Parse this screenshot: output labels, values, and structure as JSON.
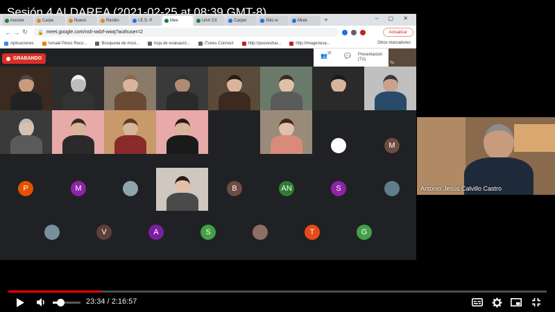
{
  "video": {
    "title": "Sesión 4 ALDAREA (2021-02-25 at 08:39 GMT-8)",
    "current_time": "23:34",
    "separator": " / ",
    "duration": "2:16:57",
    "progress_fraction": 0.172,
    "volume_fraction": 0.28
  },
  "browser": {
    "tabs": [
      {
        "label": "mooser",
        "color": "#188038"
      },
      {
        "label": "Carpe",
        "color": "#ea8600"
      },
      {
        "label": "Nuevo",
        "color": "#ea8600"
      },
      {
        "label": "Resttin",
        "color": "#ea8600"
      },
      {
        "label": "I.E.S. P",
        "color": "#1a73e8"
      },
      {
        "label": "Mee",
        "color": "#188038"
      },
      {
        "label": "UAX Cit",
        "color": "#188038"
      },
      {
        "label": "Carpet",
        "color": "#1a73e8"
      },
      {
        "label": "Sitio w",
        "color": "#1a73e8"
      },
      {
        "label": "Misle",
        "color": "#1a73e8"
      }
    ],
    "url": "meet.google.com/nsh-wdzf-wwq?authuser=2",
    "update_label": "Actualizar",
    "bookmarks": [
      {
        "label": "Aplicaciones",
        "color": "#4285f4"
      },
      {
        "label": "Ismael Perez Reco...",
        "color": "#ea8600"
      },
      {
        "label": "Búsqueda de músi...",
        "color": "#5f6368"
      },
      {
        "label": "hoja de evaluació...",
        "color": "#5f6368"
      },
      {
        "label": "iTunes Connect",
        "color": "#5f6368"
      },
      {
        "label": "http://pooveshar...",
        "color": "#c5221f"
      },
      {
        "label": "http://imagenesa...",
        "color": "#c5221f"
      }
    ],
    "bookmarks_other": "Otros marcadores"
  },
  "meet": {
    "recording_label": "GRABANDO",
    "participant_count": "32",
    "presentation_label": "Presentación (Tú)",
    "self_label": "Tú",
    "speaker_name": "Antonio Jesús Calvillo Castro",
    "avatars": [
      {
        "letter": "",
        "color": "#ffffff"
      },
      {
        "letter": "M",
        "color": "#6d4c41"
      },
      {
        "letter": "P",
        "color": "#e65100"
      },
      {
        "letter": "M",
        "color": "#8e24aa"
      },
      {
        "letter": "",
        "color": "#90a4ae"
      },
      {
        "letter": "B",
        "color": "#6d4c41"
      },
      {
        "letter": "AN",
        "color": "#2e7d32"
      },
      {
        "letter": "S",
        "color": "#8e24aa"
      },
      {
        "letter": "",
        "color": "#607d8b"
      },
      {
        "letter": "",
        "color": "#78909c"
      },
      {
        "letter": "V",
        "color": "#5d4037"
      },
      {
        "letter": "A",
        "color": "#7b1fa2"
      },
      {
        "letter": "S",
        "color": "#43a047"
      },
      {
        "letter": "",
        "color": "#8d6e63"
      },
      {
        "letter": "T",
        "color": "#e64a19"
      },
      {
        "letter": "G",
        "color": "#43a047"
      }
    ]
  },
  "icons": {
    "play": "play-icon",
    "volume": "volume-icon",
    "subtitles": "subtitles-icon",
    "settings": "gear-icon",
    "miniplayer": "miniplayer-icon",
    "fullscreen": "fullscreen-icon"
  }
}
